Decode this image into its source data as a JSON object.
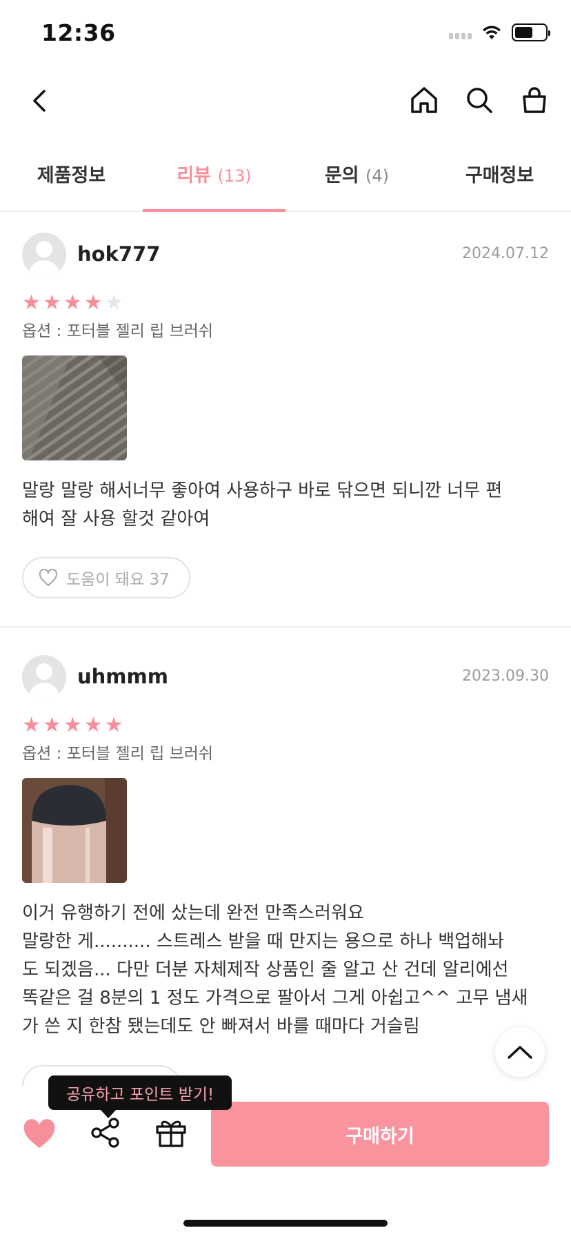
{
  "status": {
    "time": "12:36"
  },
  "tabs": [
    {
      "label": "제품정보",
      "count": ""
    },
    {
      "label": "리뷰",
      "count": "(13)"
    },
    {
      "label": "문의",
      "count": "(4)"
    },
    {
      "label": "구매정보",
      "count": ""
    }
  ],
  "reviews": [
    {
      "user": "hok777",
      "date": "2024.07.12",
      "rating": 4,
      "option": "옵션 : 포터블 젤리 립 브러쉬",
      "text": "말랑 말랑 해서너무 좋아여 사용하구 바로 닦으면 되니깐 너무 편\n해여 잘 사용 할것 같아여",
      "helpful_label": "도움이 돼요 37"
    },
    {
      "user": "uhmmm",
      "date": "2023.09.30",
      "rating": 5,
      "option": "옵션 : 포터블 젤리 립 브러쉬",
      "text": "이거 유행하기 전에 샀는데 완전 만족스러워요\n말랑한 게.......... 스트레스 받을 때 만지는 용으로 하나 백업해놔\n도 되겠음... 다만 더분 자체제작 상품인 줄 알고 산 건데 알리에선\n똑같은 걸 8분의 1 정도 가격으로 팔아서 그게 아쉽고^^ 고무 냄새\n가 쓴 지 한참 됐는데도 안 빠져서 바를 때마다 거슬림"
    }
  ],
  "tooltip": "공유하고 포인트 받기!",
  "buy_label": "구매하기",
  "colors": {
    "accent": "#f78f9b",
    "buy_button": "#f9949f"
  },
  "icons": [
    "back-icon",
    "home-icon",
    "search-icon",
    "bag-icon",
    "heart-icon",
    "share-icon",
    "gift-icon",
    "chevron-up-icon"
  ]
}
